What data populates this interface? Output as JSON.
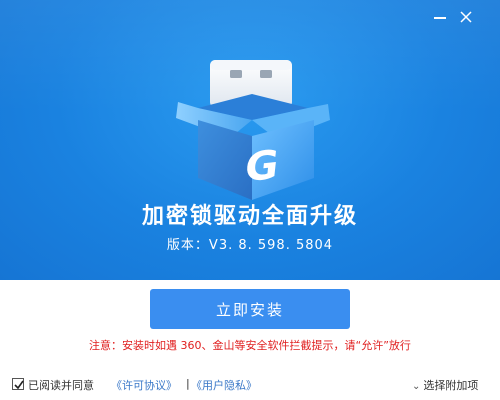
{
  "window": {
    "minimize_icon": "minimize-icon",
    "close_icon": "close-icon"
  },
  "hero": {
    "title": "加密锁驱动全面升级",
    "version": "版本：V3. 8. 598. 5804",
    "logo_letter": "G",
    "logo_icon": "usb-box-logo"
  },
  "main": {
    "install_button": "立即安装",
    "notice": "注意：安装时如遇 360、金山等安全软件拦截提示，请“允许”放行"
  },
  "footer": {
    "agree_checked": true,
    "agree_label": "已阅读并同意",
    "license_link": "《许可协议》",
    "separator": "|",
    "privacy_link": "《用户隐私》",
    "options_label": "选择附加项"
  },
  "colors": {
    "hero_bg": "#1a82e0",
    "button_bg": "#3a8ef0",
    "notice": "#e02020",
    "link": "#3a78c8"
  }
}
